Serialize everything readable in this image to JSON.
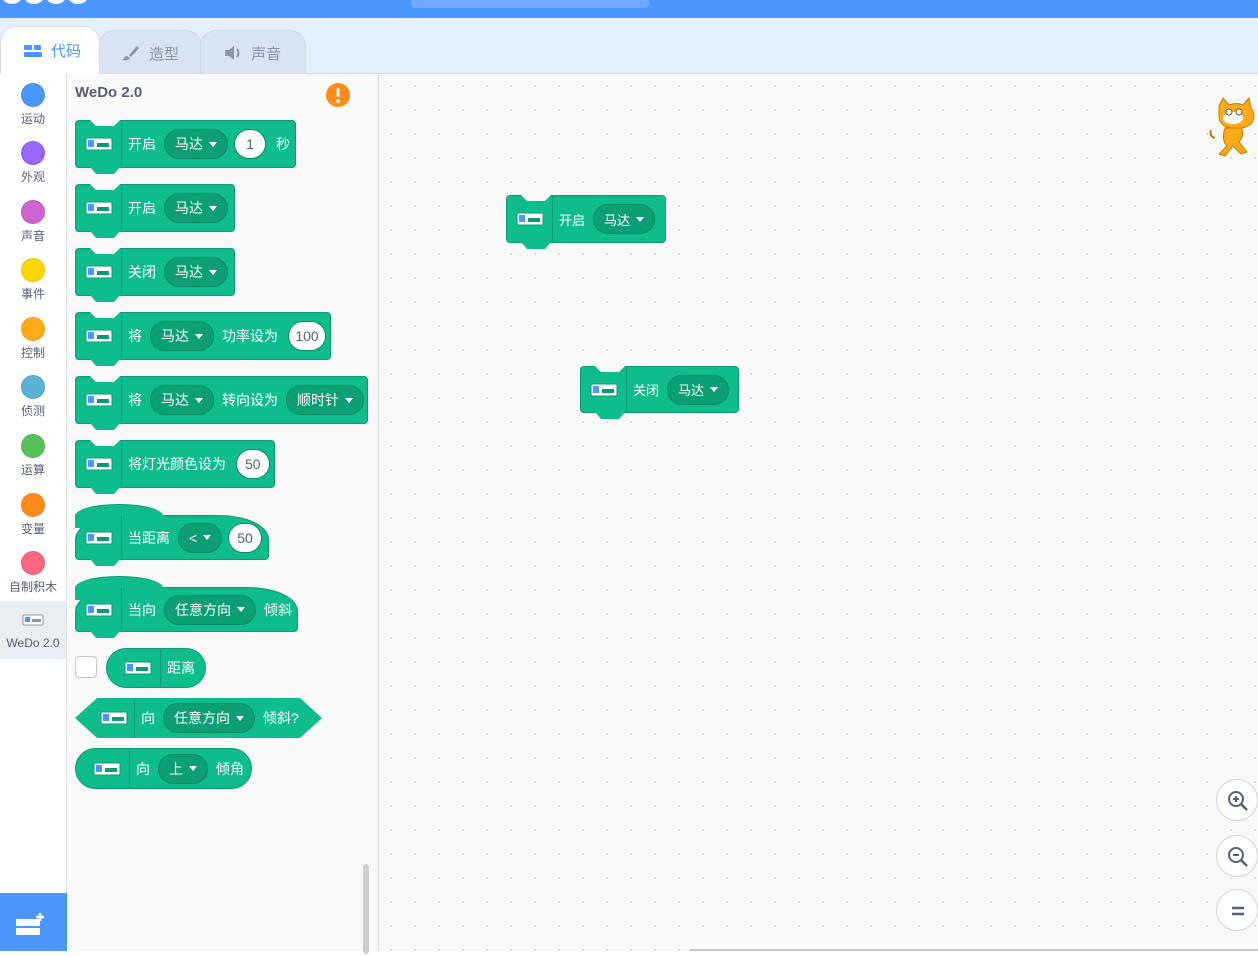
{
  "tabs": {
    "code": "代码",
    "costumes": "造型",
    "sounds": "声音"
  },
  "categories": [
    {
      "label": "运动",
      "color": "#4c97ff"
    },
    {
      "label": "外观",
      "color": "#9966ff"
    },
    {
      "label": "声音",
      "color": "#cf63cf"
    },
    {
      "label": "事件",
      "color": "#ffd500"
    },
    {
      "label": "控制",
      "color": "#ffab19"
    },
    {
      "label": "侦测",
      "color": "#5cb1d6"
    },
    {
      "label": "运算",
      "color": "#59c059"
    },
    {
      "label": "变量",
      "color": "#ff8c1a"
    },
    {
      "label": "自制积木",
      "color": "#ff6680"
    },
    {
      "label": "WeDo 2.0",
      "color": "#0fbd8c"
    }
  ],
  "flyout": {
    "heading": "WeDo 2.0",
    "blocks": {
      "b1": {
        "l1": "开启",
        "dd": "马达",
        "val": "1",
        "l2": "秒"
      },
      "b2": {
        "l1": "开启",
        "dd": "马达"
      },
      "b3": {
        "l1": "关闭",
        "dd": "马达"
      },
      "b4": {
        "l1": "将",
        "dd": "马达",
        "l2": "功率设为",
        "val": "100"
      },
      "b5": {
        "l1": "将",
        "dd": "马达",
        "l2": "转向设为",
        "dd2": "顺时针"
      },
      "b6": {
        "l1": "将灯光颜色设为",
        "val": "50"
      },
      "b7": {
        "l1": "当距离",
        "dd": "<",
        "val": "50"
      },
      "b8": {
        "l1": "当向",
        "dd": "任意方向",
        "l2": "倾斜"
      },
      "b9": {
        "l1": "距离"
      },
      "b10": {
        "l1": "向",
        "dd": "任意方向",
        "l2": "倾斜?"
      },
      "b11": {
        "l1": "向",
        "dd": "上",
        "l2": "倾角"
      }
    }
  },
  "workspace": {
    "w1": {
      "l1": "开启",
      "dd": "马达"
    },
    "w2": {
      "l1": "关闭",
      "dd": "马达"
    }
  },
  "zoom": {
    "in": "zoom-in",
    "out": "zoom-out",
    "reset": "zoom-reset"
  }
}
